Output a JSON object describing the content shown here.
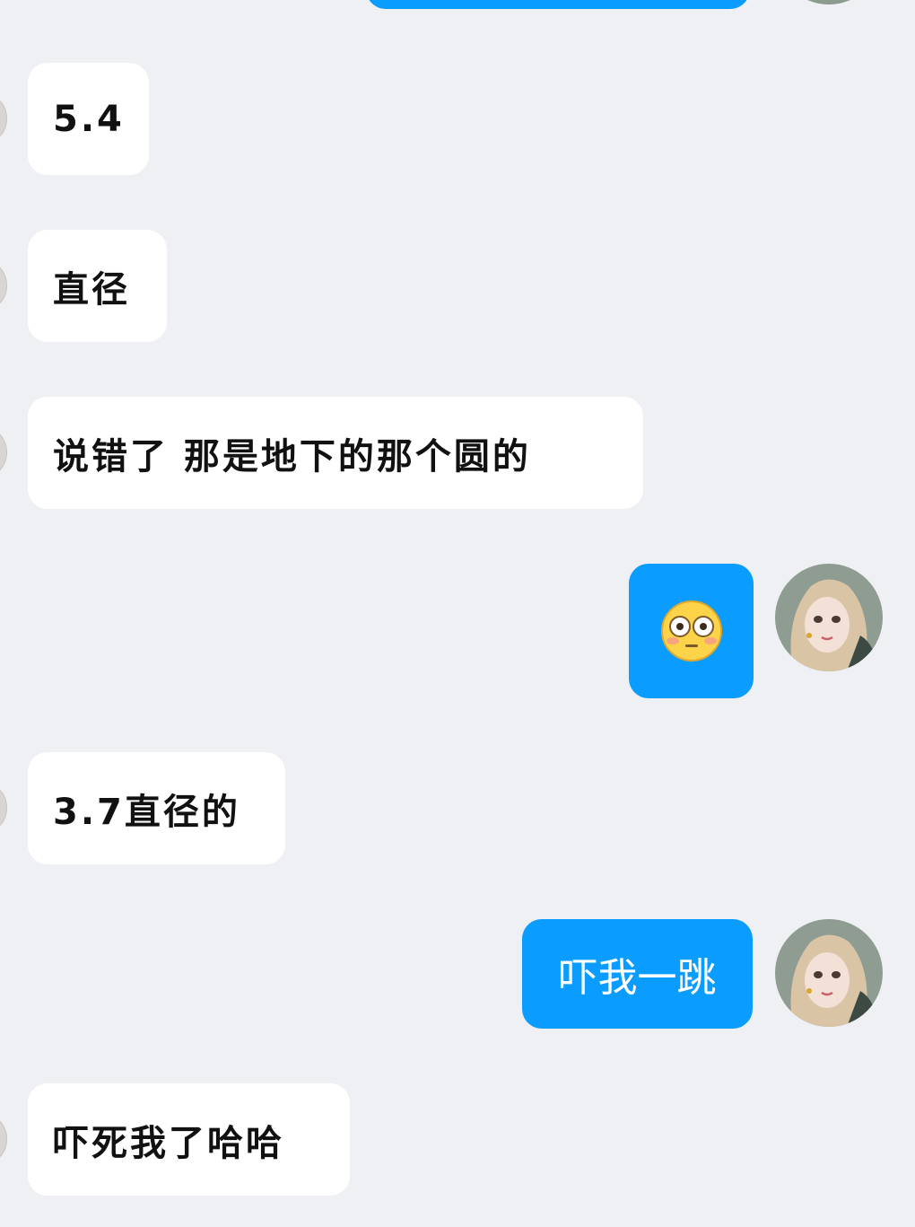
{
  "messages": [
    {
      "side": "incoming",
      "text": "5.4"
    },
    {
      "side": "incoming",
      "text": "直径"
    },
    {
      "side": "incoming",
      "text": "说错了  那是地下的那个圆的"
    },
    {
      "side": "outgoing",
      "type": "emoji",
      "emoji": "flushed-face"
    },
    {
      "side": "incoming",
      "text": "3.7直径的"
    },
    {
      "side": "outgoing",
      "text": "吓我一跳"
    },
    {
      "side": "incoming",
      "text": "吓死我了哈哈"
    }
  ],
  "colors": {
    "background": "#eff0f3",
    "incoming_bubble": "#ffffff",
    "outgoing_bubble": "#0a9cff"
  }
}
